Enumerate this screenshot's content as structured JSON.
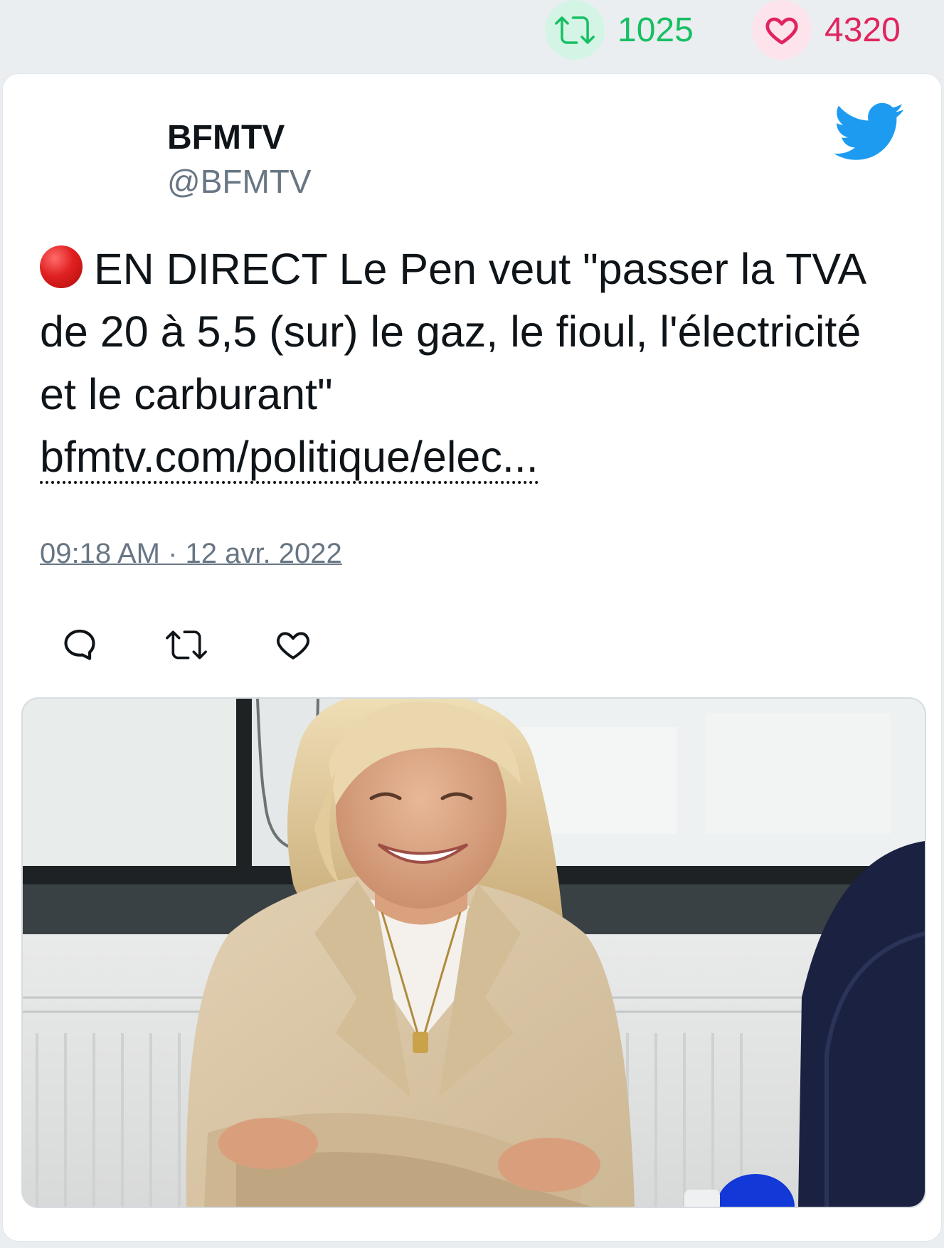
{
  "stats": {
    "retweets": "1025",
    "likes": "4320",
    "retweet_color": "#17bf63",
    "like_color": "#e0245e"
  },
  "tweet": {
    "display_name": "BFMTV",
    "handle": "@BFMTV",
    "text": "EN DIRECT Le Pen veut \"passer la TVA de 20 à 5,5 (sur) le gaz, le fioul, l'électricité et le carburant\"",
    "link": "bfmtv.com/politique/elec...",
    "timestamp": "09:18 AM · 12 avr. 2022"
  },
  "icons": {
    "header": "twitter-bird-icon",
    "status": "red-circle-emoji",
    "actions": [
      "reply-icon",
      "retweet-icon",
      "like-icon"
    ]
  },
  "colors": {
    "brand": "#1d9bf0",
    "page_background": "#ebeef1"
  }
}
